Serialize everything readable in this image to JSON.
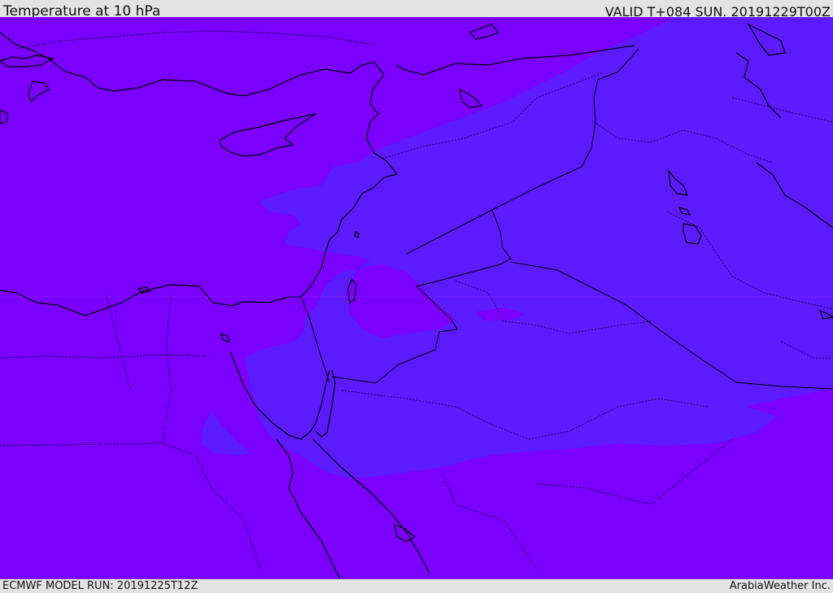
{
  "header": {
    "title": "Temperature at 10 hPa",
    "valid": "VALID T+084 SUN. 20191229T00Z"
  },
  "footer": {
    "model_run": "ECMWF MODEL RUN: 20191225T12Z",
    "credit": "ArabiaWeather Inc."
  },
  "colors": {
    "field_outer": "#7a00ff",
    "field_inner": "#5c1aff",
    "coastline": "#000000",
    "bar_background": "#e3e3e3"
  }
}
